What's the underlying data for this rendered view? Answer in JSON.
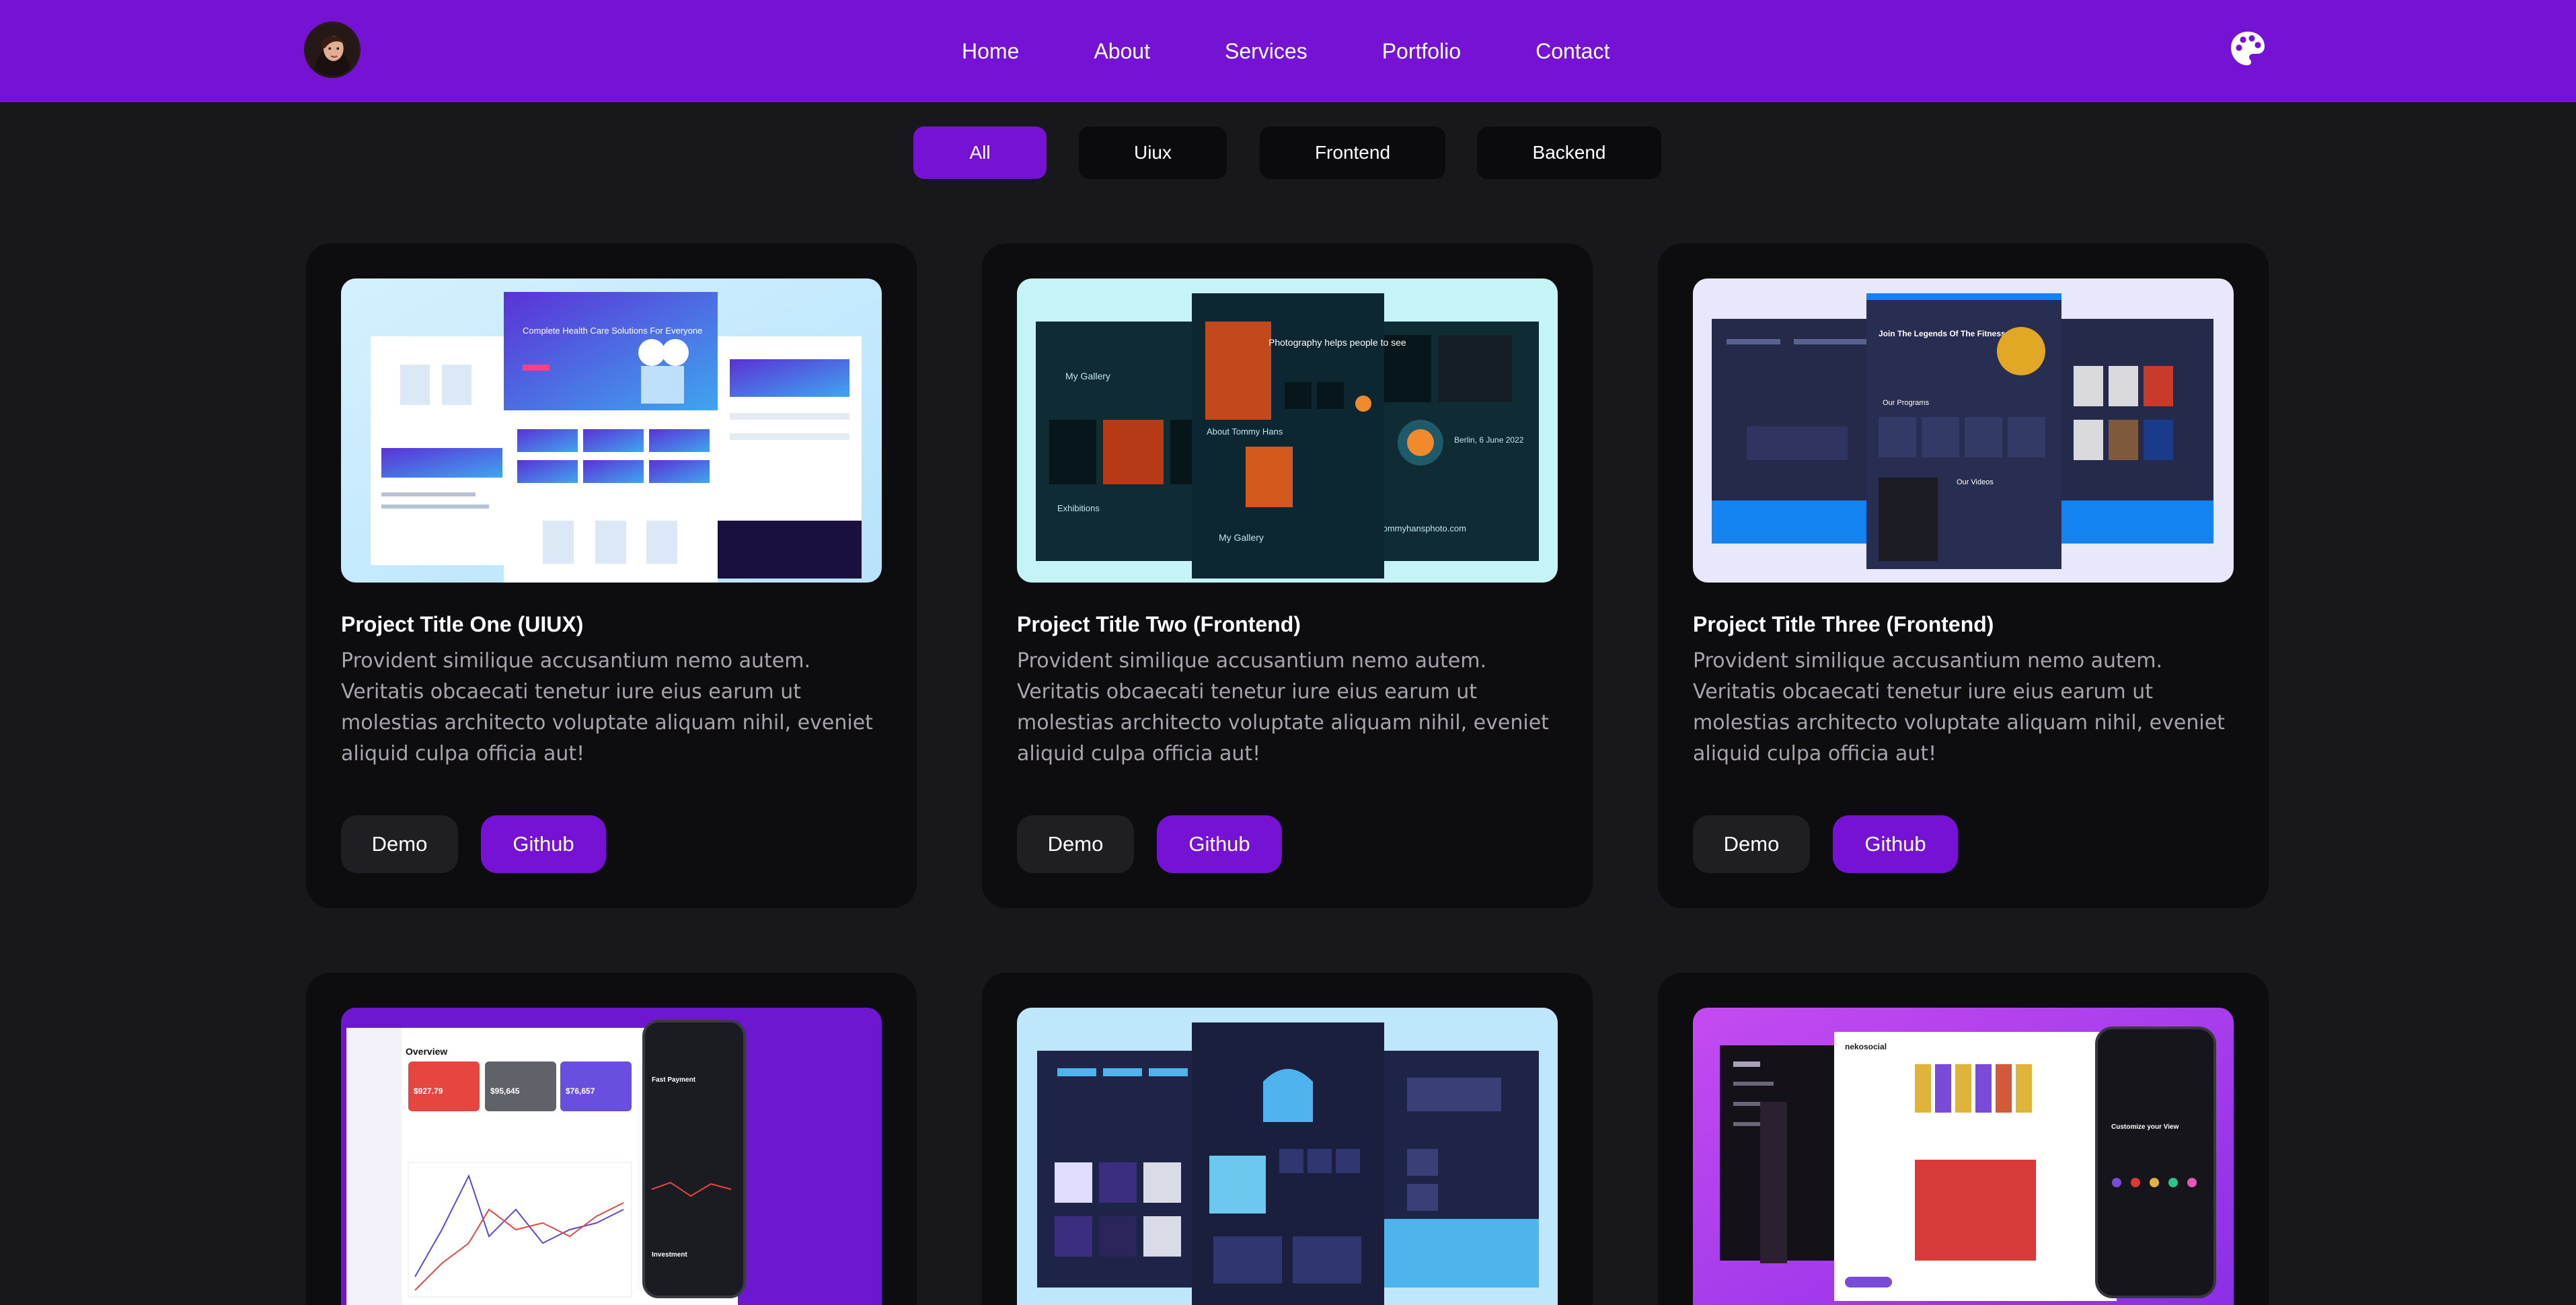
{
  "nav": {
    "links": [
      "Home",
      "About",
      "Services",
      "Portfolio",
      "Contact"
    ]
  },
  "icons": {
    "avatar": "profile-avatar",
    "theme": "palette-icon"
  },
  "colors": {
    "accent": "#7612d4",
    "background": "#18171b",
    "card": "#0d0c0f",
    "button_dark": "#1f1e22",
    "muted_text": "#a7a4ad"
  },
  "filters": {
    "items": [
      "All",
      "Uiux",
      "Frontend",
      "Backend"
    ],
    "selected": "All"
  },
  "projects": [
    {
      "title": "Project Title One (UIUX)",
      "description": "Provident similique accusantium nemo autem. Veritatis obcaecati tenetur iure eius earum ut molestias architecto voluptate aliquam nihil, eveniet aliquid culpa officia aut!",
      "demo": "Demo",
      "github": "Github",
      "preview": {
        "heading": "Complete Health Care Solutions For Everyone"
      }
    },
    {
      "title": "Project Title Two (Frontend)",
      "description": "Provident similique accusantium nemo autem. Veritatis obcaecati tenetur iure eius earum ut molestias architecto voluptate aliquam nihil, eveniet aliquid culpa officia aut!",
      "demo": "Demo",
      "github": "Github",
      "preview": {
        "heading": "Photography helps people to see",
        "gallery": "My Gallery",
        "about": "About Tommy Hans",
        "exhibitions": "Exhibitions",
        "gallery2": "My Gallery",
        "site": "tommyhansphoto.com",
        "date": "Berlin, 6 June 2022"
      }
    },
    {
      "title": "Project Title Three (Frontend)",
      "description": "Provident similique accusantium nemo autem. Veritatis obcaecati tenetur iure eius earum ut molestias architecto voluptate aliquam nihil, eveniet aliquid culpa officia aut!",
      "demo": "Demo",
      "github": "Github",
      "preview": {
        "heading": "Join The Legends Of The Fitness World",
        "programs": "Our Programs",
        "videos": "Our Videos"
      }
    },
    {
      "title": "",
      "description": "",
      "demo": "",
      "github": "",
      "preview": {
        "overview": "Overview",
        "payment": "Fast Payment",
        "investment": "Investment",
        "amounts": [
          "$927.79",
          "$95,645",
          "$76,657"
        ]
      }
    },
    {
      "title": "",
      "description": "",
      "demo": "",
      "github": "",
      "preview": {}
    },
    {
      "title": "",
      "description": "",
      "demo": "",
      "github": "",
      "preview": {
        "brand": "nekosocial",
        "customize": "Customize your View"
      }
    }
  ]
}
